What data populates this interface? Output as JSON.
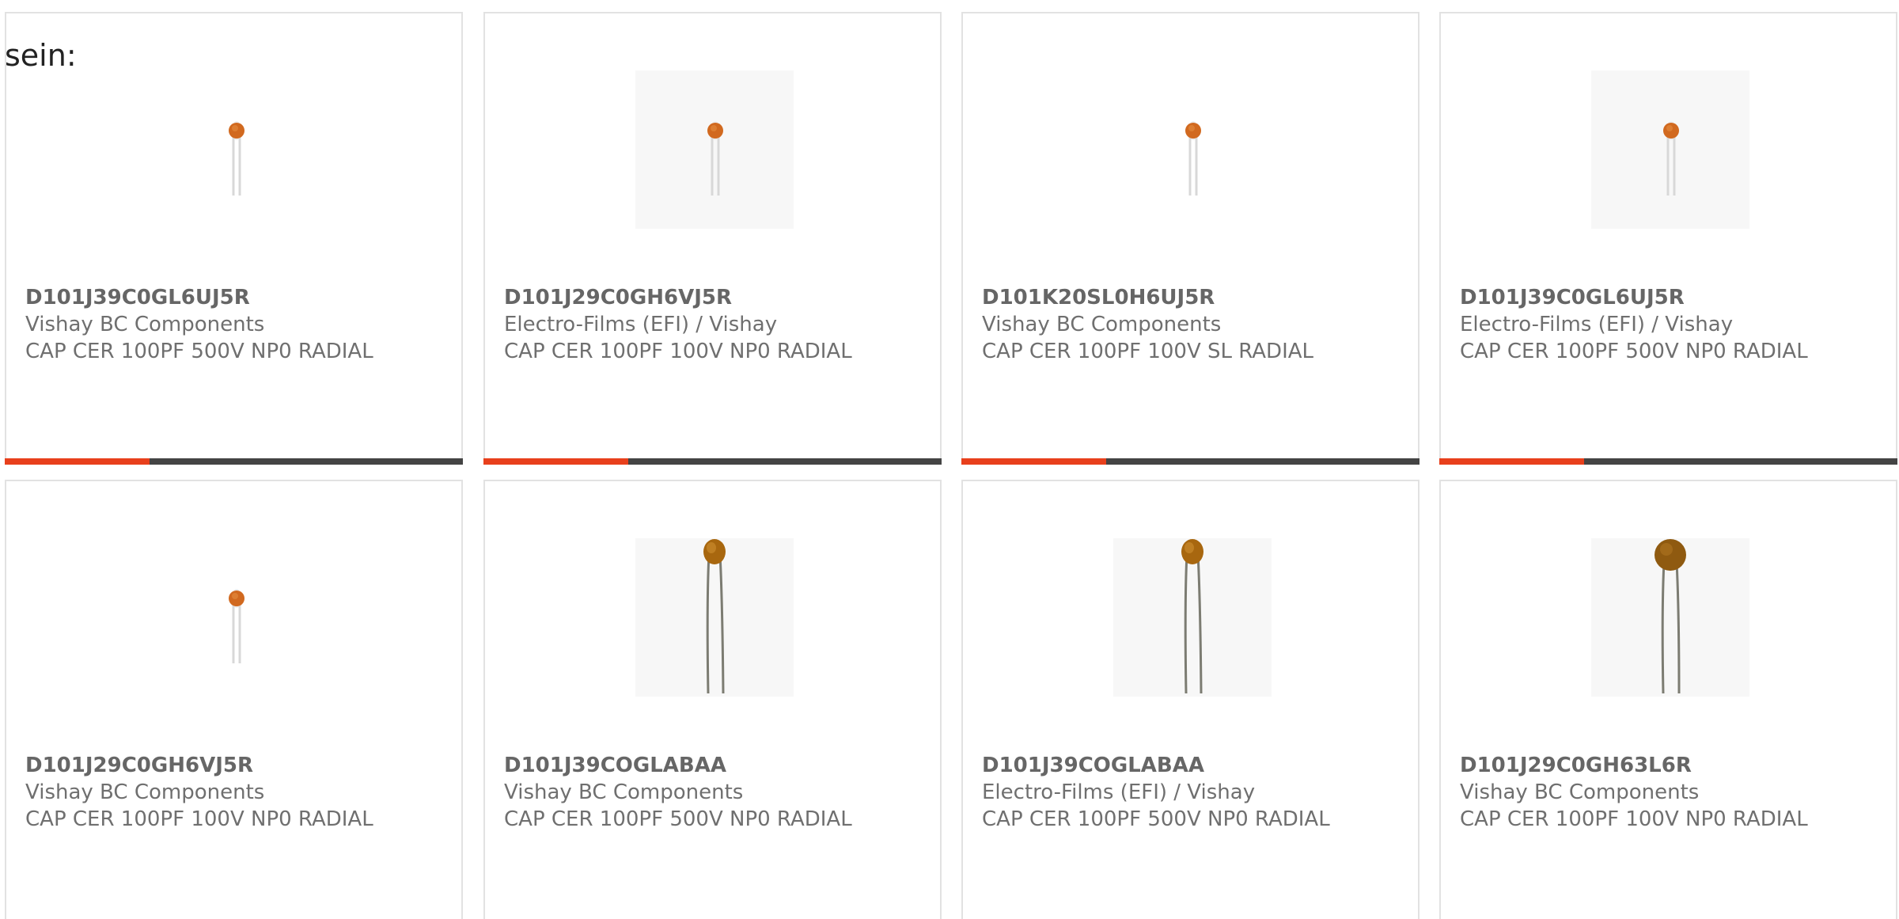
{
  "intro_text": "sein:",
  "colors": {
    "accent": "#e8401c",
    "bar": "#444444",
    "border": "#e2e2e2",
    "text": "#6f6f6f"
  },
  "cards": [
    {
      "part_number": "D101J39C0GL6UJ5R",
      "manufacturer": "Vishay BC Components",
      "description": "CAP CER 100PF 500V NP0 RADIAL",
      "image": "small-ceramic-disc-capacitor",
      "highlighted": true
    },
    {
      "part_number": "D101J29C0GH6VJ5R",
      "manufacturer": "Electro-Films (EFI) / Vishay",
      "description": "CAP CER 100PF 100V NP0 RADIAL",
      "image": "small-ceramic-disc-capacitor",
      "highlighted": true
    },
    {
      "part_number": "D101K20SL0H6UJ5R",
      "manufacturer": "Vishay BC Components",
      "description": "CAP CER 100PF 100V SL RADIAL",
      "image": "small-ceramic-disc-capacitor",
      "highlighted": true
    },
    {
      "part_number": "D101J39C0GL6UJ5R",
      "manufacturer": "Electro-Films (EFI) / Vishay",
      "description": "CAP CER 100PF 500V NP0 RADIAL",
      "image": "small-ceramic-disc-capacitor",
      "highlighted": true
    },
    {
      "part_number": "D101J29C0GH6VJ5R",
      "manufacturer": "Vishay BC Components",
      "description": "CAP CER 100PF 100V NP0 RADIAL",
      "image": "small-ceramic-disc-capacitor",
      "highlighted": false
    },
    {
      "part_number": "D101J39COGLABAA",
      "manufacturer": "Vishay BC Components",
      "description": "CAP CER 100PF 500V NP0 RADIAL",
      "image": "large-ceramic-disc-capacitor",
      "highlighted": false
    },
    {
      "part_number": "D101J39COGLABAA",
      "manufacturer": "Electro-Films (EFI) / Vishay",
      "description": "CAP CER 100PF 500V NP0 RADIAL",
      "image": "large-ceramic-disc-capacitor",
      "highlighted": false
    },
    {
      "part_number": "D101J29C0GH63L6R",
      "manufacturer": "Vishay BC Components",
      "description": "CAP CER 100PF 100V NP0 RADIAL",
      "image": "large-ceramic-disc-capacitor-dark",
      "highlighted": false
    }
  ]
}
